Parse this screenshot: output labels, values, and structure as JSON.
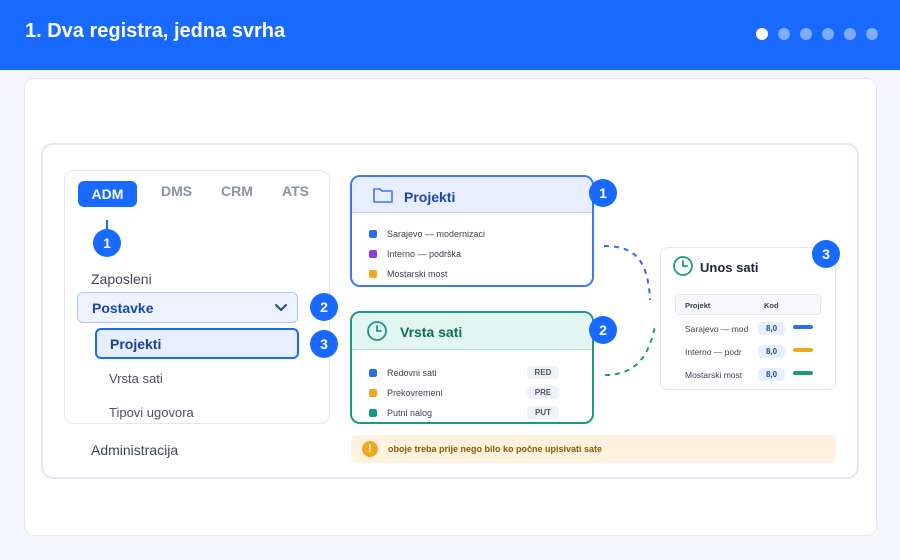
{
  "header": {
    "title": "1. Dva registra, jedna svrha",
    "slides": [
      true,
      false,
      false,
      false,
      false,
      false
    ]
  },
  "nav": {
    "tabs": [
      "ADM",
      "DMS",
      "CRM",
      "ATS"
    ],
    "badge_top": "1",
    "zaposleni": "Zaposleni",
    "postavke": "Postavke",
    "badge_postavke": "2",
    "projekti": "Projekti",
    "badge_projekti": "3",
    "vrsta_sati": "Vrsta sati",
    "tipovi_ugovora": "Tipovi ugovora",
    "administracija": "Administracija"
  },
  "projekti_card": {
    "title": "Projekti",
    "badge": "1",
    "color": "#3b78f2",
    "items": [
      {
        "label": "Sarajevo — modernizaci",
        "color": "#2f6de6"
      },
      {
        "label": "Interno — podrška",
        "color": "#8a3fe0"
      },
      {
        "label": "Mostarski most",
        "color": "#f0a81c"
      }
    ]
  },
  "vrsta_card": {
    "title": "Vrsta sati",
    "badge": "2",
    "color": "#1a9a82",
    "items": [
      {
        "label": "Redovni sati",
        "code": "RED",
        "color": "#2f6de6"
      },
      {
        "label": "Prekovremeni",
        "code": "PRE",
        "color": "#f0a81c"
      },
      {
        "label": "Putni nalog",
        "code": "PUT",
        "color": "#1a9a82"
      }
    ]
  },
  "unos_card": {
    "title": "Unos sati",
    "badge": "3",
    "col_projekt": "Projekt",
    "col_kod": "Kod",
    "rows": [
      {
        "projekt": "Sarajevo — mod",
        "value": "8,0",
        "color": "#2f6de6"
      },
      {
        "projekt": "Interno — podr",
        "value": "8,0",
        "color": "#f0a81c"
      },
      {
        "projekt": "Mostarski most",
        "value": "8,0",
        "color": "#1a9a82"
      }
    ]
  },
  "note": {
    "icon": "!",
    "text": "oboje treba prije nego bilo ko počne upisivati sate"
  }
}
